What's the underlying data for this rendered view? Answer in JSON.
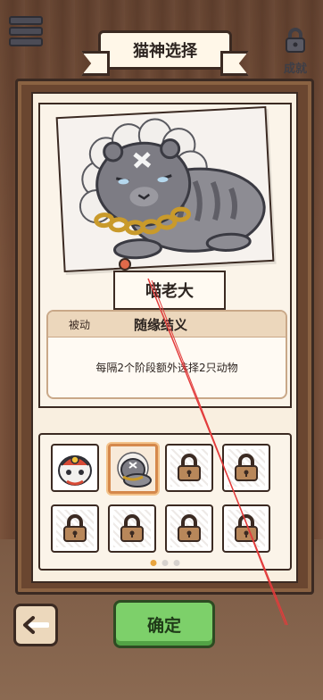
{
  "header": {
    "title": "猫神选择",
    "achievement_label": "成就"
  },
  "selected_cat": {
    "name": "喵老大",
    "skill": {
      "type": "被动",
      "name": "随缘结义",
      "description": "每隔2个阶段额外选择2只动物"
    }
  },
  "grid": {
    "slots": [
      {
        "state": "unlocked",
        "art": "lion-dance-cat"
      },
      {
        "state": "selected",
        "art": "gray-boss-cat"
      },
      {
        "state": "locked"
      },
      {
        "state": "locked"
      },
      {
        "state": "locked"
      },
      {
        "state": "locked"
      },
      {
        "state": "locked"
      },
      {
        "state": "locked"
      }
    ],
    "page_count": 3,
    "current_page": 1
  },
  "footer": {
    "confirm_label": "确定"
  },
  "colors": {
    "confirm_green": "#7dd06a",
    "selected_border": "#d5884c",
    "page_dot_active": "#e9a53f"
  }
}
